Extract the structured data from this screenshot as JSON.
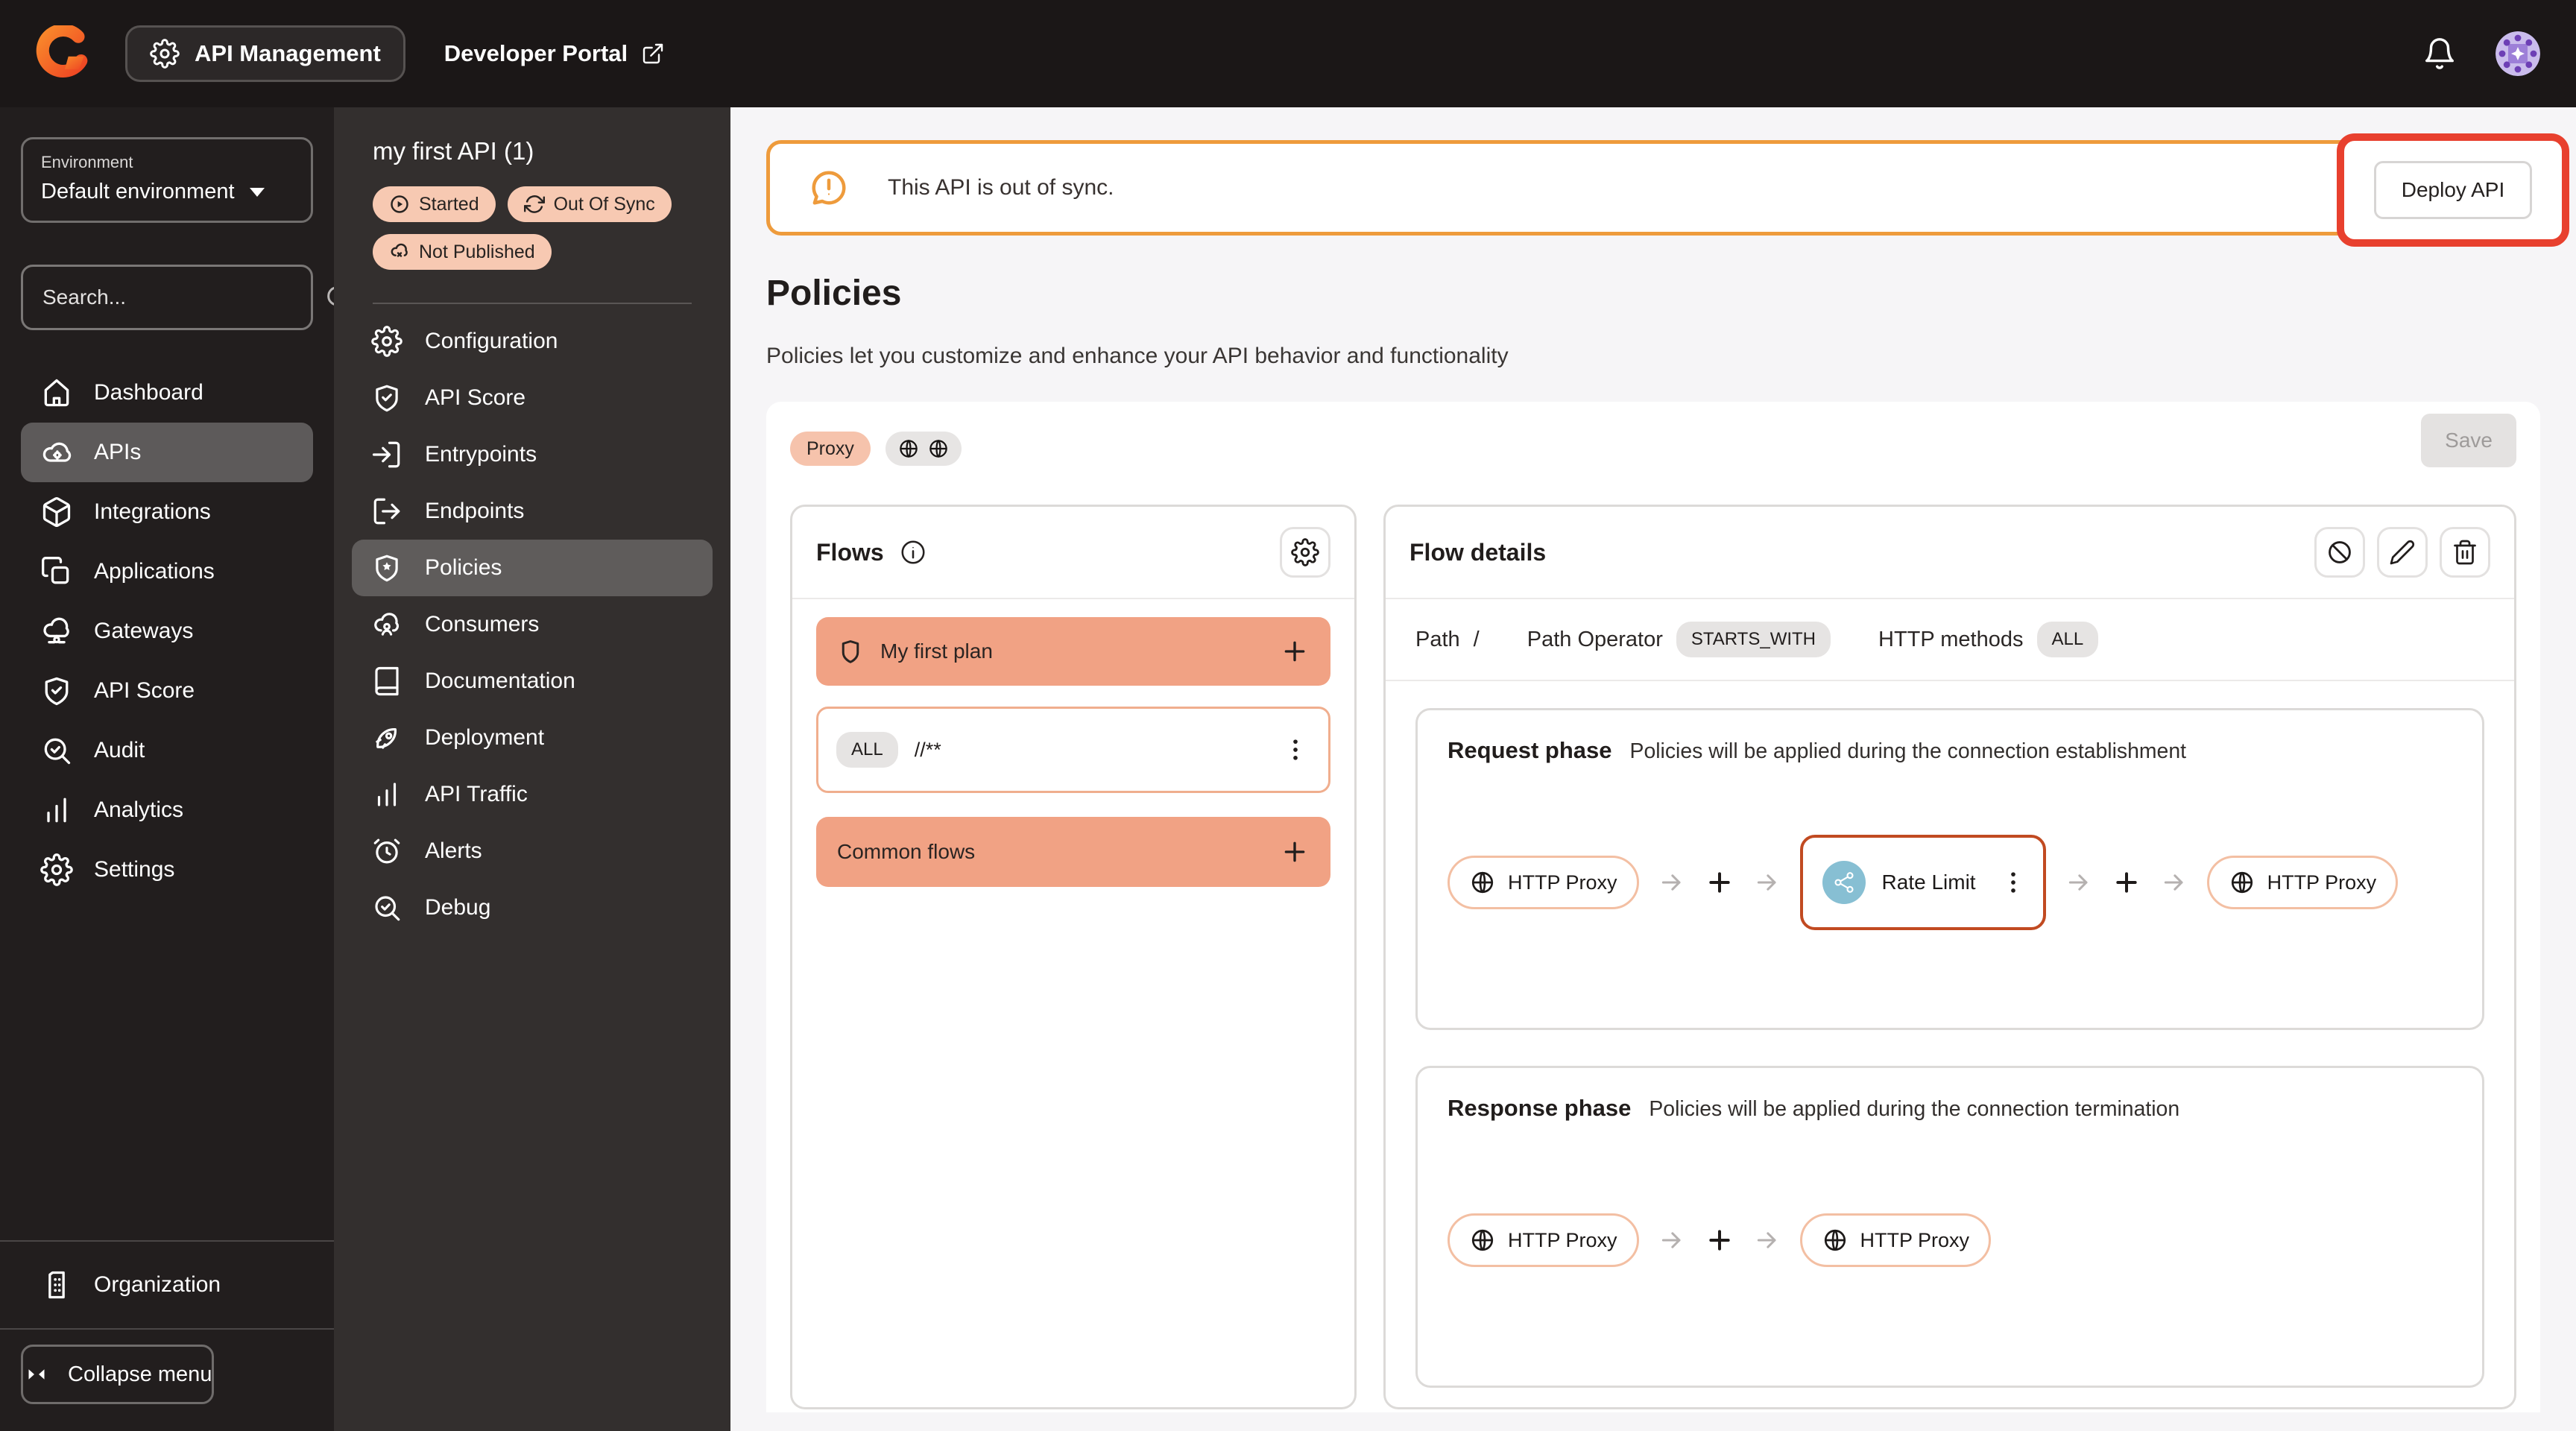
{
  "topbar": {
    "app_switcher": "API Management",
    "portal_link": "Developer Portal"
  },
  "sidebar": {
    "environment_label": "Environment",
    "environment_value": "Default environment",
    "search_placeholder": "Search...",
    "items": [
      {
        "label": "Dashboard"
      },
      {
        "label": "APIs"
      },
      {
        "label": "Integrations"
      },
      {
        "label": "Applications"
      },
      {
        "label": "Gateways"
      },
      {
        "label": "API Score"
      },
      {
        "label": "Audit"
      },
      {
        "label": "Analytics"
      },
      {
        "label": "Settings"
      }
    ],
    "organization_label": "Organization",
    "collapse_label": "Collapse menu"
  },
  "api_sidebar": {
    "title": "my first API (1)",
    "badges": [
      {
        "label": "Started"
      },
      {
        "label": "Out Of Sync"
      },
      {
        "label": "Not Published"
      }
    ],
    "items": [
      {
        "label": "Configuration"
      },
      {
        "label": "API Score"
      },
      {
        "label": "Entrypoints"
      },
      {
        "label": "Endpoints"
      },
      {
        "label": "Policies"
      },
      {
        "label": "Consumers"
      },
      {
        "label": "Documentation"
      },
      {
        "label": "Deployment"
      },
      {
        "label": "API Traffic"
      },
      {
        "label": "Alerts"
      },
      {
        "label": "Debug"
      }
    ]
  },
  "main": {
    "banner": {
      "message": "This API is out of sync.",
      "deploy_label": "Deploy API"
    },
    "page": {
      "title": "Policies",
      "subtitle": "Policies let you customize and enhance your API behavior and functionality"
    },
    "toolbar": {
      "proxy_chip": "Proxy",
      "save_label": "Save"
    },
    "flows": {
      "title": "Flows",
      "plan_name": "My first plan",
      "flow_method": "ALL",
      "flow_path": "//**",
      "common_name": "Common flows"
    },
    "flow_details": {
      "title": "Flow details",
      "path_label": "Path",
      "path_value": "/",
      "operator_label": "Path Operator",
      "operator_value": "STARTS_WITH",
      "methods_label": "HTTP methods",
      "methods_value": "ALL",
      "request": {
        "title": "Request phase",
        "description": "Policies will be applied during the connection establishment",
        "start_connector": "HTTP Proxy",
        "policy": "Rate Limit",
        "end_connector": "HTTP Proxy"
      },
      "response": {
        "title": "Response phase",
        "description": "Policies will be applied during the connection termination",
        "start_connector": "HTTP Proxy",
        "end_connector": "HTTP Proxy"
      }
    }
  },
  "colors": {
    "accent_salmon": "#f1a284",
    "badge_salmon": "#f7c9b2",
    "banner_orange": "#ee9b3c",
    "annotation_red": "#e8402e",
    "policy_border": "#c14a21",
    "policy_teal": "#87bfd3",
    "topbar_bg": "#1b1717",
    "sidebar_bg": "#221e1e",
    "api_sidebar_bg": "#332f2e"
  }
}
